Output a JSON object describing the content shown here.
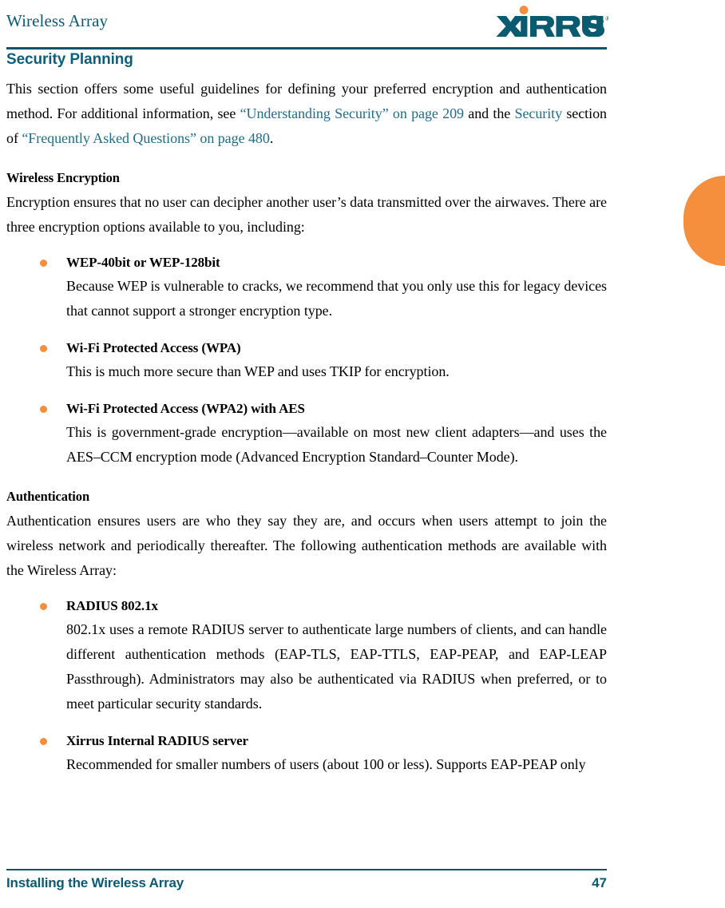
{
  "header": {
    "title": "Wireless Array",
    "logo_text": "XIRRUS",
    "logo_trademark": "®",
    "logo_color": "#0A5A70",
    "logo_dot_color": "#F58F3E",
    "rule_color": "#07546B"
  },
  "section": {
    "title": "Security Planning",
    "title_color": "#08607B",
    "intro": {
      "part1": "This section offers some useful guidelines for defining your preferred encryption and authentication method. For additional information, see ",
      "link1": "“Understanding Security” on page 209",
      "part2": " and the ",
      "link2": "Security",
      "part3": " section of ",
      "link3": "“Frequently Asked Questions” on page 480",
      "part4": "."
    }
  },
  "wireless_encryption": {
    "heading": "Wireless Encryption",
    "intro": "Encryption ensures that no user can decipher another user’s data transmitted over the airwaves. There are three encryption options available to you, including:",
    "bullets": [
      {
        "title": "WEP-40bit or WEP-128bit",
        "body": "Because WEP is vulnerable to cracks, we recommend that you only use this for legacy devices that cannot support a stronger encryption type."
      },
      {
        "title": "Wi-Fi Protected Access (WPA)",
        "body": "This is much more secure than WEP and uses TKIP for encryption."
      },
      {
        "title": "Wi-Fi Protected Access (WPA2) with AES",
        "body": "This is government-grade encryption—available on most new client adapters—and uses the AES–CCM encryption mode (Advanced Encryption Standard–Counter Mode)."
      }
    ]
  },
  "authentication": {
    "heading": "Authentication",
    "intro": "Authentication ensures users are who they say they are, and occurs when users attempt to join the wireless network and periodically thereafter. The following authentication methods are available with the Wireless Array:",
    "bullets": [
      {
        "title": "RADIUS 802.1x",
        "body": "802.1x uses a remote RADIUS server to authenticate large numbers of clients, and can handle different authentication methods (EAP-TLS, EAP-TTLS, EAP-PEAP, and EAP-LEAP Passthrough). Administrators may also be authenticated via RADIUS when preferred, or to meet particular security standards."
      },
      {
        "title": "Xirrus Internal RADIUS server",
        "body": "Recommended for smaller numbers of users (about 100 or less). Supports EAP-PEAP only"
      }
    ]
  },
  "footer": {
    "left": "Installing the Wireless Array",
    "page_number": "47",
    "color": "#0B5A72"
  },
  "edge_tab": {
    "color": "#F58F3E"
  }
}
